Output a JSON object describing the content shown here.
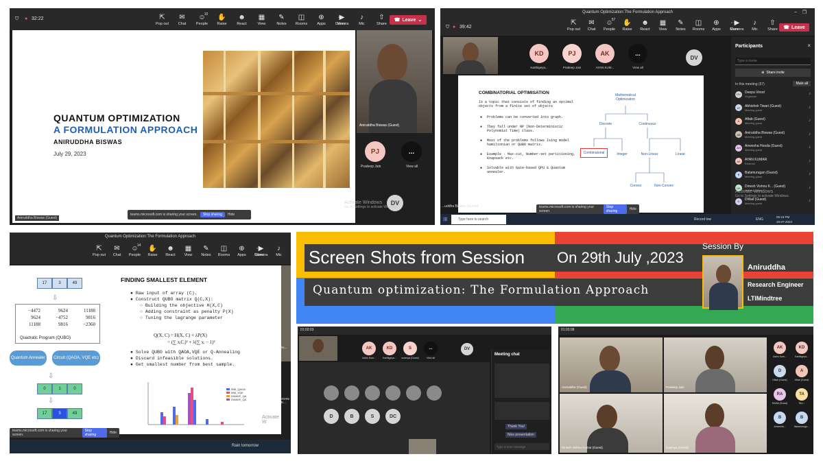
{
  "panel_a": {
    "timer": "32:22",
    "toolbar": [
      {
        "label": "Pop out",
        "icon": "pop-out-icon"
      },
      {
        "label": "Chat",
        "icon": "chat-icon"
      },
      {
        "label": "People",
        "icon": "people-icon",
        "count": "10"
      },
      {
        "label": "Raise",
        "icon": "raise-hand-icon"
      },
      {
        "label": "React",
        "icon": "react-icon"
      },
      {
        "label": "View",
        "icon": "view-icon"
      },
      {
        "label": "Notes",
        "icon": "notes-icon"
      },
      {
        "label": "Rooms",
        "icon": "rooms-icon"
      },
      {
        "label": "Apps",
        "icon": "apps-icon"
      },
      {
        "label": "More",
        "icon": "more-icon"
      }
    ],
    "media": [
      {
        "label": "Camera",
        "icon": "camera-icon"
      },
      {
        "label": "Mic",
        "icon": "mic-icon"
      },
      {
        "label": "Share",
        "icon": "share-icon"
      }
    ],
    "leave_label": "Leave",
    "slide": {
      "title_line1": "QUANTUM OPTIMIZATION",
      "title_line2": "A FORMULATION APPROACH",
      "author": "ANIRUDDHA BISWAS",
      "date": "July 29, 2023"
    },
    "presenter_tag": "Aniruddha Biswas (Guest)",
    "video_name": "Aniruddha Biswas (Guest)",
    "tiles": [
      {
        "initials": "PJ",
        "name": "Pradeep Jain"
      },
      {
        "initials": "...",
        "name": "View all"
      }
    ],
    "dv": "DV",
    "share_text": "teams.microsoft.com is sharing your screen.",
    "stop_sharing": "Stop sharing",
    "hide": "Hide",
    "watermark_1": "Activate Windows",
    "watermark_2": "Go to Settings to activate Windows."
  },
  "panel_b": {
    "window_title": "Quantum Optimization:The Formulation Approach",
    "timer": "39:42",
    "toolbar": [
      "Pop out",
      "Chat",
      "People",
      "Raise",
      "React",
      "View",
      "Notes",
      "Rooms",
      "Apps",
      "More"
    ],
    "people_count": "57",
    "media": [
      "Camera",
      "Mic",
      "Share"
    ],
    "leave_label": "Leave",
    "tiles": [
      {
        "initials": "KD",
        "name": "Karthigeya...",
        "color": "#f4c7c3"
      },
      {
        "initials": "PJ",
        "name": "Pradeep Jain",
        "color": "#f9d3d0"
      },
      {
        "initials": "AK",
        "name": "AYAN KUM...",
        "color": "#f4c7c3"
      },
      {
        "initials": "...",
        "name": "View all",
        "color": "#111111"
      }
    ],
    "dv": "DV",
    "slide": {
      "heading": "COMBINATORIAL OPTIMISATION",
      "intro": "Is a topic that consists of finding an optimal objects from a finite set of objects",
      "bullets": [
        "Problems can be converted into graph.",
        "They fall under NP (Non-Deterministic Polynomial Time) class.",
        "Most of the problems follows Ising model hamiltonian or QUBO matrix.",
        "Example - Max-cut, Number-set partitioning, Knapsack etc.",
        "Solvable with Gate-based QPU & Quantum annealer."
      ],
      "tree": {
        "root": "Mathematical Optimization",
        "discrete": "Discrete",
        "continuous": "Continuous",
        "combinatorial": "Combinatorial",
        "integer": "Integer",
        "nonlinear": "Non-Linear",
        "linear": "Linear",
        "convex": "Convex",
        "nonconvex": "Non-Convex"
      }
    },
    "share_text": "teams.microsoft.com is sharing your screen.",
    "stop_sharing": "Stop sharing",
    "hide": "Hide",
    "presenter_tag": "...uddha Biswas (Guest)",
    "participants": {
      "title": "Participants",
      "search_placeholder": "Type a name",
      "share_invite": "Share invite",
      "section": "In this meeting (57)",
      "mute_all": "Mute all",
      "list": [
        {
          "initials": "DV",
          "name": "Deepa Vinod",
          "role": "Organizer",
          "color": "#d5d5d5"
        },
        {
          "initials": "AT",
          "name": "Abhishek Tiwari (Guest)",
          "role": "Meeting guest",
          "color": "#cbd9e8"
        },
        {
          "initials": "A",
          "name": "Aftab (Guest)",
          "role": "Meeting guest",
          "color": "#f3c5b5"
        },
        {
          "initials": "AB",
          "name": "Aniruddha Biswas (Guest)",
          "role": "Meeting guest",
          "color": "#c9c2b8"
        },
        {
          "initials": "AH",
          "name": "Anwesha Hooda (Guest)",
          "role": "Meeting guest",
          "color": "#e8c6e8"
        },
        {
          "initials": "AK",
          "name": "AYAN KUMAR",
          "role": "External",
          "color": "#f4c7c3"
        },
        {
          "initials": "B",
          "name": "Balamurugan (Guest)",
          "role": "Meeting guest",
          "color": "#c6d8f2"
        },
        {
          "initials": "DK",
          "name": "Dinesh Vishnu K... (Guest)",
          "role": "Meeting guest",
          "color": "#c6e8d4"
        },
        {
          "initials": "D",
          "name": "DWail (Guest)",
          "role": "Meeting guest",
          "color": "#d8d0f0"
        }
      ]
    },
    "watermark_1": "Activate Windows",
    "watermark_2": "Go to Settings to activate Windows.",
    "taskbar": {
      "search": "Type here to search",
      "status": "Record low",
      "lang": "ENG",
      "time": "06:16 PM",
      "date": "29-07-2023"
    }
  },
  "panel_c": {
    "window_title": "Quantum Optimization:The Formulation Approach",
    "toolbar": [
      "Pop out",
      "Chat",
      "People",
      "Raise",
      "React",
      "View",
      "Notes",
      "Rooms",
      "Apps",
      "More"
    ],
    "people_count": "14",
    "media": [
      "Camera",
      "Mic"
    ],
    "slide": {
      "heading": "FINDING SMALLEST ELEMENT",
      "array": [
        "17",
        "3",
        "49"
      ],
      "matrix_rows": [
        [
          "−4472",
          "9624",
          "11188"
        ],
        [
          "9624",
          "−4752",
          "9816"
        ],
        [
          "11188",
          "9816",
          "−2360"
        ]
      ],
      "qubo_label": "Quadratic Program (QUBO)",
      "annealer": "Quantum Annealer",
      "circuit": "Circuit (QAOA, VQE etc)",
      "result_bits": [
        "0",
        "1",
        "0"
      ],
      "result_array": [
        "17",
        "3",
        "49"
      ],
      "bullets": [
        "Raw input of array (C).",
        "Construct QUBO matrix Q(C,X):"
      ],
      "sub_bullets": [
        "Building the objective H(X,C)",
        "Adding constraint as penalty P(X)",
        "Tuning the lagrange parameter"
      ],
      "formula_1": "Q(X, C) = H(X, C) + λP(X)",
      "formula_2": "= (∑ xᵢCᵢ)² + λ(∑ xᵢ − 1)²",
      "bullets_2": [
        "Solve QUBO with QAOA,VQE or Q-Annealing",
        "Discard infeasible solutions.",
        "Get smallest number from best sample."
      ],
      "legend": [
        "IBM_QAOA",
        "IBM_VQE",
        "DWAVE_QA",
        "DWAVE_QA"
      ]
    },
    "share_text": "teams.microsoft.com is sharing your screen.",
    "stop_sharing": "Stop sharing",
    "hide": "Hide",
    "weather": "Rain tomorrow",
    "side_tag_1": "Aniru...",
    "side_tag_2": "AYAN K..."
  },
  "banner": {
    "title": "Screen Shots from Session",
    "date": "On 29th July ,2023",
    "subtitle": "Quantum optimization: The Formulation Approach",
    "session_by": "Session By",
    "speaker_name": "Aniruddha",
    "speaker_role": "Research Engineer",
    "speaker_org": "LTIMindtree",
    "colors": {
      "red": "#ea4335",
      "yellow": "#fbbc04",
      "green": "#34a853",
      "blue": "#4285f4"
    }
  },
  "panel_d": {
    "timer": "01:02:03",
    "tiles": [
      {
        "initials": "AK",
        "name": "Ashis Kum..."
      },
      {
        "initials": "KD",
        "name": "Karthigeya..."
      },
      {
        "initials": "S",
        "name": "sowmya (Guest)"
      },
      {
        "initials": "...",
        "name": "View all"
      }
    ],
    "dv": "DV",
    "gallery": [
      "D",
      "B",
      "S",
      "DC"
    ],
    "chat_title": "Meeting chat",
    "chat_messages": [
      "Thank You!",
      "Nice presentation"
    ],
    "chat_input_placeholder": "Type a new message"
  },
  "panel_e": {
    "timer": "01:03:08",
    "roster": [
      {
        "initials": "AK",
        "name": "Ashis Kum..."
      },
      {
        "initials": "KD",
        "name": "Karthigeya..."
      },
      {
        "initials": "D",
        "name": "Dillah (Guest)"
      },
      {
        "initials": "A",
        "name": "Aftab (Guest)"
      },
      {
        "initials": "RA",
        "name": "RAMA (Guest)"
      },
      {
        "initials": "TA",
        "name": "TAU..."
      },
      {
        "initials": "B",
        "name": "Anwesha..."
      },
      {
        "initials": "B",
        "name": "Balamuruga..."
      }
    ],
    "video_names": [
      "Aniruddha (Guest)",
      "Pradeep Jain",
      "Dinesh Vishnu Kumar (Guest)",
      "sowmya (Guest)"
    ]
  }
}
